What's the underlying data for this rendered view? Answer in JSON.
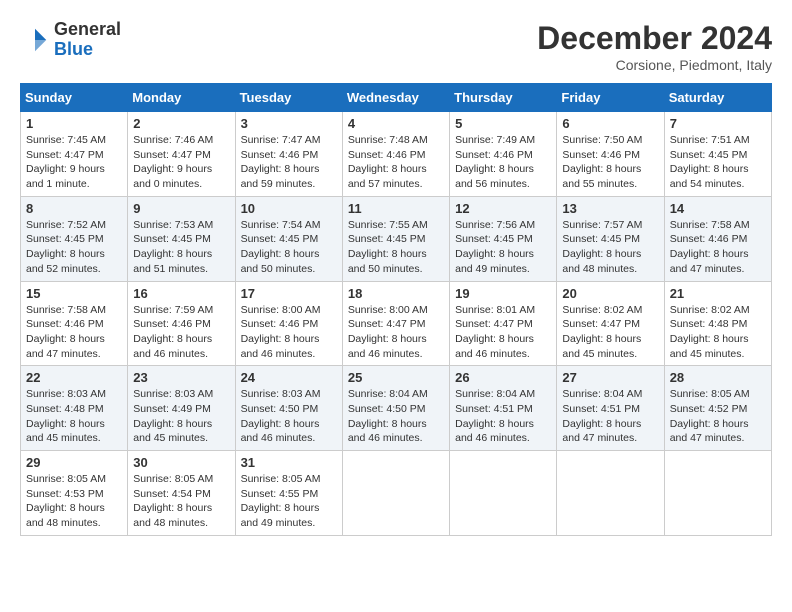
{
  "header": {
    "logo_general": "General",
    "logo_blue": "Blue",
    "month_title": "December 2024",
    "location": "Corsione, Piedmont, Italy"
  },
  "columns": [
    "Sunday",
    "Monday",
    "Tuesday",
    "Wednesday",
    "Thursday",
    "Friday",
    "Saturday"
  ],
  "weeks": [
    [
      {
        "day": "1",
        "sunrise": "Sunrise: 7:45 AM",
        "sunset": "Sunset: 4:47 PM",
        "daylight": "Daylight: 9 hours and 1 minute."
      },
      {
        "day": "2",
        "sunrise": "Sunrise: 7:46 AM",
        "sunset": "Sunset: 4:47 PM",
        "daylight": "Daylight: 9 hours and 0 minutes."
      },
      {
        "day": "3",
        "sunrise": "Sunrise: 7:47 AM",
        "sunset": "Sunset: 4:46 PM",
        "daylight": "Daylight: 8 hours and 59 minutes."
      },
      {
        "day": "4",
        "sunrise": "Sunrise: 7:48 AM",
        "sunset": "Sunset: 4:46 PM",
        "daylight": "Daylight: 8 hours and 57 minutes."
      },
      {
        "day": "5",
        "sunrise": "Sunrise: 7:49 AM",
        "sunset": "Sunset: 4:46 PM",
        "daylight": "Daylight: 8 hours and 56 minutes."
      },
      {
        "day": "6",
        "sunrise": "Sunrise: 7:50 AM",
        "sunset": "Sunset: 4:46 PM",
        "daylight": "Daylight: 8 hours and 55 minutes."
      },
      {
        "day": "7",
        "sunrise": "Sunrise: 7:51 AM",
        "sunset": "Sunset: 4:45 PM",
        "daylight": "Daylight: 8 hours and 54 minutes."
      }
    ],
    [
      {
        "day": "8",
        "sunrise": "Sunrise: 7:52 AM",
        "sunset": "Sunset: 4:45 PM",
        "daylight": "Daylight: 8 hours and 52 minutes."
      },
      {
        "day": "9",
        "sunrise": "Sunrise: 7:53 AM",
        "sunset": "Sunset: 4:45 PM",
        "daylight": "Daylight: 8 hours and 51 minutes."
      },
      {
        "day": "10",
        "sunrise": "Sunrise: 7:54 AM",
        "sunset": "Sunset: 4:45 PM",
        "daylight": "Daylight: 8 hours and 50 minutes."
      },
      {
        "day": "11",
        "sunrise": "Sunrise: 7:55 AM",
        "sunset": "Sunset: 4:45 PM",
        "daylight": "Daylight: 8 hours and 50 minutes."
      },
      {
        "day": "12",
        "sunrise": "Sunrise: 7:56 AM",
        "sunset": "Sunset: 4:45 PM",
        "daylight": "Daylight: 8 hours and 49 minutes."
      },
      {
        "day": "13",
        "sunrise": "Sunrise: 7:57 AM",
        "sunset": "Sunset: 4:45 PM",
        "daylight": "Daylight: 8 hours and 48 minutes."
      },
      {
        "day": "14",
        "sunrise": "Sunrise: 7:58 AM",
        "sunset": "Sunset: 4:46 PM",
        "daylight": "Daylight: 8 hours and 47 minutes."
      }
    ],
    [
      {
        "day": "15",
        "sunrise": "Sunrise: 7:58 AM",
        "sunset": "Sunset: 4:46 PM",
        "daylight": "Daylight: 8 hours and 47 minutes."
      },
      {
        "day": "16",
        "sunrise": "Sunrise: 7:59 AM",
        "sunset": "Sunset: 4:46 PM",
        "daylight": "Daylight: 8 hours and 46 minutes."
      },
      {
        "day": "17",
        "sunrise": "Sunrise: 8:00 AM",
        "sunset": "Sunset: 4:46 PM",
        "daylight": "Daylight: 8 hours and 46 minutes."
      },
      {
        "day": "18",
        "sunrise": "Sunrise: 8:00 AM",
        "sunset": "Sunset: 4:47 PM",
        "daylight": "Daylight: 8 hours and 46 minutes."
      },
      {
        "day": "19",
        "sunrise": "Sunrise: 8:01 AM",
        "sunset": "Sunset: 4:47 PM",
        "daylight": "Daylight: 8 hours and 46 minutes."
      },
      {
        "day": "20",
        "sunrise": "Sunrise: 8:02 AM",
        "sunset": "Sunset: 4:47 PM",
        "daylight": "Daylight: 8 hours and 45 minutes."
      },
      {
        "day": "21",
        "sunrise": "Sunrise: 8:02 AM",
        "sunset": "Sunset: 4:48 PM",
        "daylight": "Daylight: 8 hours and 45 minutes."
      }
    ],
    [
      {
        "day": "22",
        "sunrise": "Sunrise: 8:03 AM",
        "sunset": "Sunset: 4:48 PM",
        "daylight": "Daylight: 8 hours and 45 minutes."
      },
      {
        "day": "23",
        "sunrise": "Sunrise: 8:03 AM",
        "sunset": "Sunset: 4:49 PM",
        "daylight": "Daylight: 8 hours and 45 minutes."
      },
      {
        "day": "24",
        "sunrise": "Sunrise: 8:03 AM",
        "sunset": "Sunset: 4:50 PM",
        "daylight": "Daylight: 8 hours and 46 minutes."
      },
      {
        "day": "25",
        "sunrise": "Sunrise: 8:04 AM",
        "sunset": "Sunset: 4:50 PM",
        "daylight": "Daylight: 8 hours and 46 minutes."
      },
      {
        "day": "26",
        "sunrise": "Sunrise: 8:04 AM",
        "sunset": "Sunset: 4:51 PM",
        "daylight": "Daylight: 8 hours and 46 minutes."
      },
      {
        "day": "27",
        "sunrise": "Sunrise: 8:04 AM",
        "sunset": "Sunset: 4:51 PM",
        "daylight": "Daylight: 8 hours and 47 minutes."
      },
      {
        "day": "28",
        "sunrise": "Sunrise: 8:05 AM",
        "sunset": "Sunset: 4:52 PM",
        "daylight": "Daylight: 8 hours and 47 minutes."
      }
    ],
    [
      {
        "day": "29",
        "sunrise": "Sunrise: 8:05 AM",
        "sunset": "Sunset: 4:53 PM",
        "daylight": "Daylight: 8 hours and 48 minutes."
      },
      {
        "day": "30",
        "sunrise": "Sunrise: 8:05 AM",
        "sunset": "Sunset: 4:54 PM",
        "daylight": "Daylight: 8 hours and 48 minutes."
      },
      {
        "day": "31",
        "sunrise": "Sunrise: 8:05 AM",
        "sunset": "Sunset: 4:55 PM",
        "daylight": "Daylight: 8 hours and 49 minutes."
      },
      null,
      null,
      null,
      null
    ]
  ]
}
